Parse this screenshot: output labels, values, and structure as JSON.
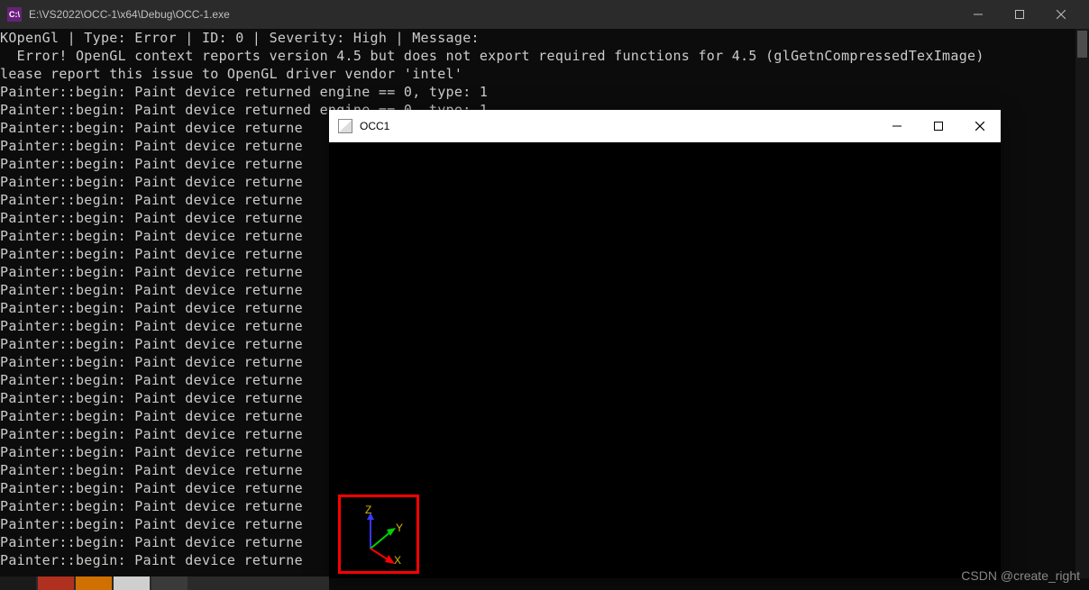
{
  "console": {
    "icon_text": "C:\\",
    "title": "E:\\VS2022\\OCC-1\\x64\\Debug\\OCC-1.exe",
    "lines": [
      "KOpenGl | Type: Error | ID: 0 | Severity: High | Message:",
      "  Error! OpenGL context reports version 4.5 but does not export required functions for 4.5 (glGetnCompressedTexImage)",
      "lease report this issue to OpenGL driver vendor 'intel'",
      "Painter::begin: Paint device returned engine == 0, type: 1",
      "Painter::begin: Paint device returned engine == 0, type: 1",
      "Painter::begin: Paint device returne",
      "Painter::begin: Paint device returne",
      "Painter::begin: Paint device returne",
      "Painter::begin: Paint device returne",
      "Painter::begin: Paint device returne",
      "Painter::begin: Paint device returne",
      "Painter::begin: Paint device returne",
      "Painter::begin: Paint device returne",
      "Painter::begin: Paint device returne",
      "Painter::begin: Paint device returne",
      "Painter::begin: Paint device returne",
      "Painter::begin: Paint device returne",
      "Painter::begin: Paint device returne",
      "Painter::begin: Paint device returne",
      "Painter::begin: Paint device returne",
      "Painter::begin: Paint device returne",
      "Painter::begin: Paint device returne",
      "Painter::begin: Paint device returne",
      "Painter::begin: Paint device returne",
      "Painter::begin: Paint device returne",
      "Painter::begin: Paint device returne",
      "Painter::begin: Paint device returne",
      "Painter::begin: Paint device returne",
      "Painter::begin: Paint device returne",
      "Painter::begin: Paint device returne"
    ]
  },
  "child_window": {
    "title": "OCC1",
    "axes": {
      "x_label": "X",
      "y_label": "Y",
      "z_label": "Z",
      "x_color": "#ff0000",
      "y_color": "#00d400",
      "z_color": "#3838ff",
      "label_color": "#d4b800"
    }
  },
  "watermark": "CSDN @create_right",
  "colors": {
    "console_bg": "#0c0c0c",
    "console_text": "#cccccc",
    "titlebar_bg": "#2b2b2b",
    "child_titlebar_bg": "#ffffff",
    "highlight_border": "#ff0000"
  }
}
